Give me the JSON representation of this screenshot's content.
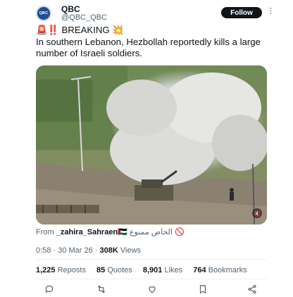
{
  "author": {
    "name": "QBC",
    "handle": "@QBC_QBC",
    "avatar_text": "QBC",
    "follow_label": "Follow",
    "more_label": "⋮"
  },
  "tweet": {
    "line1": "🚨‼️ BREAKING 💥",
    "line2": "In southern Lebanon, Hezbollah reportedly kills a large",
    "line3": "number of Israeli soldiers."
  },
  "media": {
    "mute_icon": "speaker-muted-icon"
  },
  "source": {
    "prefix": "From ",
    "account": "_zahira_Sahraen🇵🇸",
    "suffix": "الخاص ممنوع 🚫"
  },
  "meta": {
    "time": "0:58",
    "date": "30 Mar 26",
    "views_count": "308K",
    "views_label": "Views",
    "separator": "·"
  },
  "stats": {
    "reposts_count": "1,225",
    "reposts_label": "Reposts",
    "quotes_count": "85",
    "quotes_label": "Quotes",
    "likes_count": "8,901",
    "likes_label": "Likes",
    "bookmarks_count": "764",
    "bookmarks_label": "Bookmarks"
  },
  "actions": [
    "reply-icon",
    "repost-icon",
    "like-icon",
    "bookmark-icon",
    "share-icon"
  ],
  "colors": {
    "text": "#0f1419",
    "secondary": "#536471",
    "follow_bg": "#0f1419",
    "divider": "#eff3f4"
  }
}
